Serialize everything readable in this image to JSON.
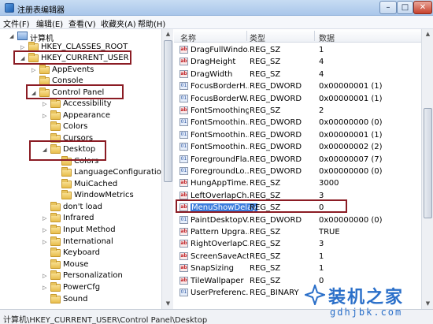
{
  "window": {
    "title": "注册表编辑器",
    "min_glyph": "–",
    "max_glyph": "□",
    "close_glyph": "✕"
  },
  "menu": [
    {
      "label": "文件(F)"
    },
    {
      "label": "编辑(E)"
    },
    {
      "label": "查看(V)"
    },
    {
      "label": "收藏夹(A)"
    },
    {
      "label": "帮助(H)"
    }
  ],
  "tree": [
    {
      "label": "计算机",
      "expander": "◢"
    },
    {
      "label": "HKEY_CLASSES_ROOT",
      "expander": "▷"
    },
    {
      "label": "HKEY_CURRENT_USER",
      "expander": "◢"
    },
    {
      "label": "AppEvents",
      "expander": "▷"
    },
    {
      "label": "Console",
      "expander": ""
    },
    {
      "label": "Control Panel",
      "expander": "◢"
    },
    {
      "label": "Accessibility",
      "expander": "▷"
    },
    {
      "label": "Appearance",
      "expander": "▷"
    },
    {
      "label": "Colors",
      "expander": ""
    },
    {
      "label": "Cursors",
      "expander": ""
    },
    {
      "label": "Desktop",
      "expander": "◢"
    },
    {
      "label": "Colors",
      "expander": ""
    },
    {
      "label": "LanguageConfiguration",
      "expander": ""
    },
    {
      "label": "MuiCached",
      "expander": ""
    },
    {
      "label": "WindowMetrics",
      "expander": ""
    },
    {
      "label": "don't load",
      "expander": ""
    },
    {
      "label": "Infrared",
      "expander": "▷"
    },
    {
      "label": "Input Method",
      "expander": "▷"
    },
    {
      "label": "International",
      "expander": "▷"
    },
    {
      "label": "Keyboard",
      "expander": ""
    },
    {
      "label": "Mouse",
      "expander": ""
    },
    {
      "label": "Personalization",
      "expander": "▷"
    },
    {
      "label": "PowerCfg",
      "expander": "▷"
    },
    {
      "label": "Sound",
      "expander": ""
    }
  ],
  "columns": {
    "name": "名称",
    "type": "类型",
    "data": "数据"
  },
  "values": [
    {
      "name": "DragFullWindo...",
      "type": "REG_SZ",
      "data": "1",
      "kind": "str"
    },
    {
      "name": "DragHeight",
      "type": "REG_SZ",
      "data": "4",
      "kind": "str"
    },
    {
      "name": "DragWidth",
      "type": "REG_SZ",
      "data": "4",
      "kind": "str"
    },
    {
      "name": "FocusBorderH...",
      "type": "REG_DWORD",
      "data": "0x00000001 (1)",
      "kind": "bin"
    },
    {
      "name": "FocusBorderW...",
      "type": "REG_DWORD",
      "data": "0x00000001 (1)",
      "kind": "bin"
    },
    {
      "name": "FontSmoothing",
      "type": "REG_SZ",
      "data": "2",
      "kind": "str"
    },
    {
      "name": "FontSmoothin...",
      "type": "REG_DWORD",
      "data": "0x00000000 (0)",
      "kind": "bin"
    },
    {
      "name": "FontSmoothin...",
      "type": "REG_DWORD",
      "data": "0x00000001 (1)",
      "kind": "bin"
    },
    {
      "name": "FontSmoothin...",
      "type": "REG_DWORD",
      "data": "0x00000002 (2)",
      "kind": "bin"
    },
    {
      "name": "ForegroundFla...",
      "type": "REG_DWORD",
      "data": "0x00000007 (7)",
      "kind": "bin"
    },
    {
      "name": "ForegroundLo...",
      "type": "REG_DWORD",
      "data": "0x00000000 (0)",
      "kind": "bin"
    },
    {
      "name": "HungAppTime...",
      "type": "REG_SZ",
      "data": "3000",
      "kind": "str"
    },
    {
      "name": "LeftOverlapCh...",
      "type": "REG_SZ",
      "data": "3",
      "kind": "str"
    },
    {
      "name": "MenuShowDelay",
      "type": "REG_SZ",
      "data": "0",
      "kind": "str",
      "selected": true
    },
    {
      "name": "PaintDesktopV...",
      "type": "REG_DWORD",
      "data": "0x00000000 (0)",
      "kind": "bin"
    },
    {
      "name": "Pattern Upgra...",
      "type": "REG_SZ",
      "data": "TRUE",
      "kind": "str"
    },
    {
      "name": "RightOverlapC...",
      "type": "REG_SZ",
      "data": "3",
      "kind": "str"
    },
    {
      "name": "ScreenSaveActi...",
      "type": "REG_SZ",
      "data": "1",
      "kind": "str"
    },
    {
      "name": "SnapSizing",
      "type": "REG_SZ",
      "data": "1",
      "kind": "str"
    },
    {
      "name": "TileWallpaper",
      "type": "REG_SZ",
      "data": "0",
      "kind": "str"
    },
    {
      "name": "UserPreferenc...",
      "type": "REG_BINARY",
      "data": "",
      "kind": "bin"
    }
  ],
  "icons": {
    "string_glyph": "ab",
    "binary_glyph": "01"
  },
  "status": {
    "path": "计算机\\HKEY_CURRENT_USER\\Control Panel\\Desktop"
  },
  "watermark": {
    "text": "装机之家",
    "url": "gdhjbk.com"
  },
  "colors": {
    "highlight_box": "#8b1c24",
    "selection": "#3b7ddd",
    "watermark": "#2a6fc9"
  }
}
